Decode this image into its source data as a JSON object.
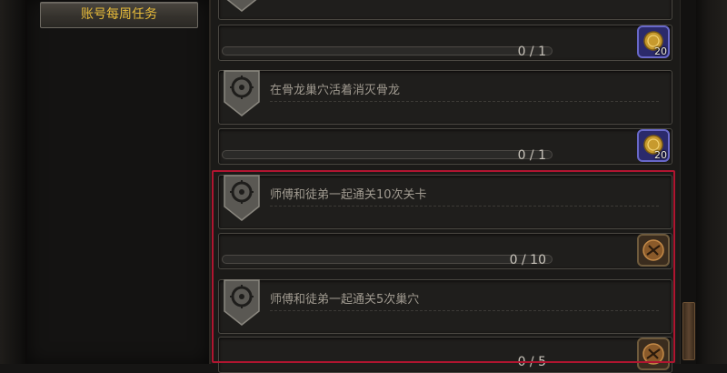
{
  "sidebar": {
    "category_label": "账号每周任务"
  },
  "quests": [
    {
      "title": "",
      "progress_label": "0 / 1",
      "progress": 0,
      "reward_icon": "gold-coin-icon",
      "reward_qty": "20"
    },
    {
      "title": "在骨龙巢穴活着消灭骨龙",
      "progress_label": "0 / 1",
      "progress": 0,
      "reward_icon": "gold-coin-icon",
      "reward_qty": "20"
    },
    {
      "title": "师傅和徒弟一起通关10次关卡",
      "progress_label": "0 / 10",
      "progress": 0,
      "reward_icon": "bronze-medal-icon",
      "reward_qty": ""
    },
    {
      "title": "师傅和徒弟一起通关5次巢穴",
      "progress_label": "0 / 5",
      "progress": 0,
      "reward_icon": "bronze-medal-icon",
      "reward_qty": ""
    }
  ],
  "colors": {
    "category_text": "#e7bb3a",
    "highlight_border": "#b01530",
    "reward_blue": "#2b2a6b",
    "reward_brown": "#3a2c1e"
  }
}
